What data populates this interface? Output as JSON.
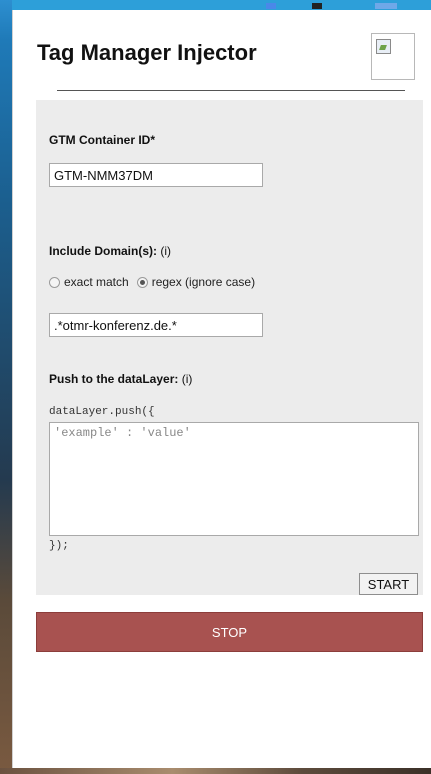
{
  "header": {
    "title": "Tag Manager Injector",
    "logo_icon": "broken-image-icon"
  },
  "container_id": {
    "label": "GTM Container ID*",
    "value": "GTM-NMM37DM"
  },
  "domains": {
    "label": "Include Domain(s):",
    "info": "(i)",
    "options": [
      {
        "label": "exact match",
        "checked": false
      },
      {
        "label": "regex (ignore case)",
        "checked": true
      }
    ],
    "value": ".*otmr-konferenz.de.*"
  },
  "datalayer": {
    "label": "Push to the dataLayer:",
    "info": "(i)",
    "code_open": "dataLayer.push({",
    "placeholder": "'example' : 'value'",
    "code_close": "});"
  },
  "buttons": {
    "start": "START",
    "stop": "STOP"
  },
  "colors": {
    "stop_button": "#a85250",
    "panel": "#ececec"
  }
}
